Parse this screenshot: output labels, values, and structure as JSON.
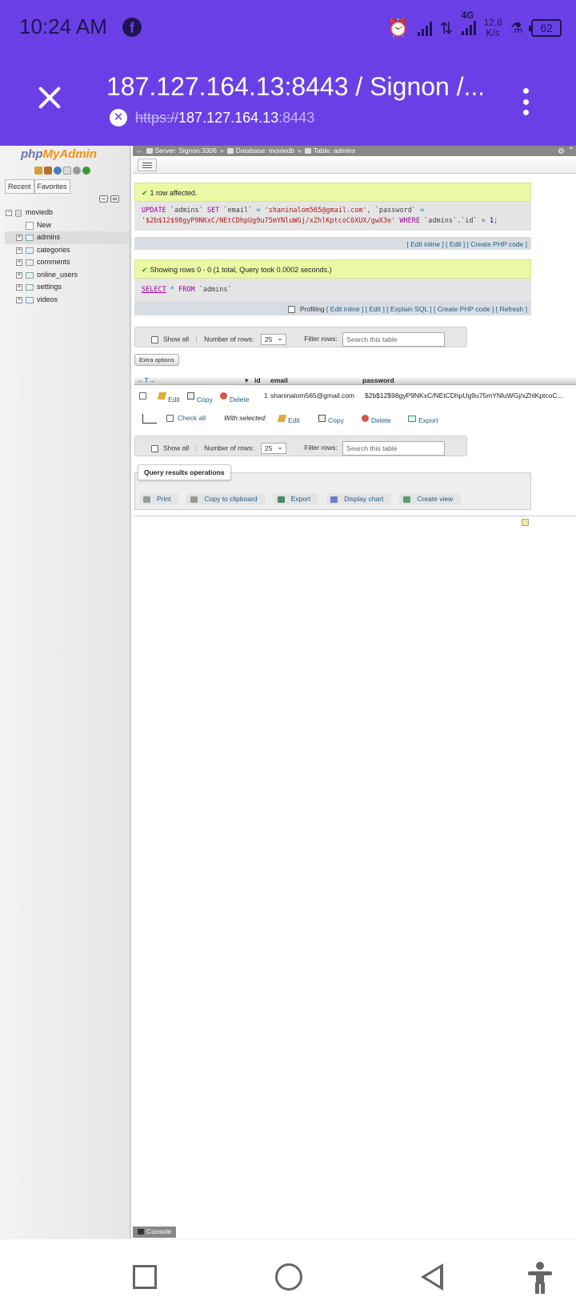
{
  "status": {
    "time": "10:24 AM",
    "network_type": "4G",
    "speed_value": "12.8",
    "speed_unit": "K/s",
    "battery": "62"
  },
  "browser": {
    "page_title": "187.127.164.13:8443 / Signon /...",
    "url_protocol": "https://",
    "url_host": "187.127.164.13",
    "url_port": ":8443"
  },
  "nav": {
    "logo_php": "php",
    "logo_myadmin": "MyAdmin",
    "tabs": [
      "Recent",
      "Favorites"
    ],
    "database": "moviedb",
    "new_label": "New",
    "tables": [
      "admins",
      "categories",
      "comments",
      "online_users",
      "settings",
      "videos"
    ]
  },
  "breadcrumb": {
    "back": "←",
    "server": "Server: Signon:3306",
    "sep": "»",
    "database": "Database: moviedb",
    "table": "Table: admins"
  },
  "update_msg": {
    "text": "1 row affected.",
    "sql": {
      "kw_update": "UPDATE",
      "tbl": "`admins`",
      "kw_set": "SET",
      "col_email": "`email`",
      "eq": "=",
      "val_email": "'shaninalom565@gmail.com'",
      "comma": ",",
      "col_password": "`password`",
      "val_password": "'$2b$12$98gyP9NKxC/NEtCDhpUg9u75mYNluWGj/xZhlKptcoC6XUX/gwX3e'",
      "kw_where": "WHERE",
      "where_col": "`admins`.`id`",
      "where_val": "1",
      "end": ";"
    },
    "links": [
      "[ Edit inline ]",
      "[ Edit ]",
      "[ Create PHP code ]"
    ]
  },
  "select_msg": {
    "text": "Showing rows 0 - 0 (1 total, Query took 0.0002 seconds.)",
    "sql": {
      "kw_select": "SELECT",
      "star": "*",
      "kw_from": "FROM",
      "tbl": "`admins`"
    },
    "profiling": "Profiling",
    "links": [
      "[ Edit inline ]",
      "[ Edit ]",
      "[ Explain SQL ]",
      "[ Create PHP code ]",
      "[ Refresh ]"
    ]
  },
  "toolbar": {
    "show_all": "Show all",
    "number_of_rows_label": "Number of rows:",
    "number_of_rows_value": "25",
    "filter_label": "Filter rows:",
    "filter_placeholder": "Search this table"
  },
  "extra_options": "Extra options",
  "table": {
    "sort_arrows": "←T→",
    "columns": [
      "id",
      "email",
      "password"
    ],
    "row": {
      "edit": "Edit",
      "copy": "Copy",
      "delete": "Delete",
      "id": "1",
      "email": "shaninalom565@gmail.com",
      "password": "$2b$12$98gyP9NKxC/NEtCDhpUg9u75mYNluWGj/xZhlKptcoC..."
    }
  },
  "with_selected": {
    "check_all": "Check all",
    "label": "With selected:",
    "edit": "Edit",
    "copy": "Copy",
    "delete": "Delete",
    "export": "Export"
  },
  "query_ops": {
    "title": "Query results operations",
    "links": [
      "Print",
      "Copy to clipboard",
      "Export",
      "Display chart",
      "Create view"
    ]
  },
  "console": "Console",
  "colors": {
    "header_bg": "#6a40e6",
    "success_bg": "#ebf8a4",
    "link": "#235a81"
  }
}
